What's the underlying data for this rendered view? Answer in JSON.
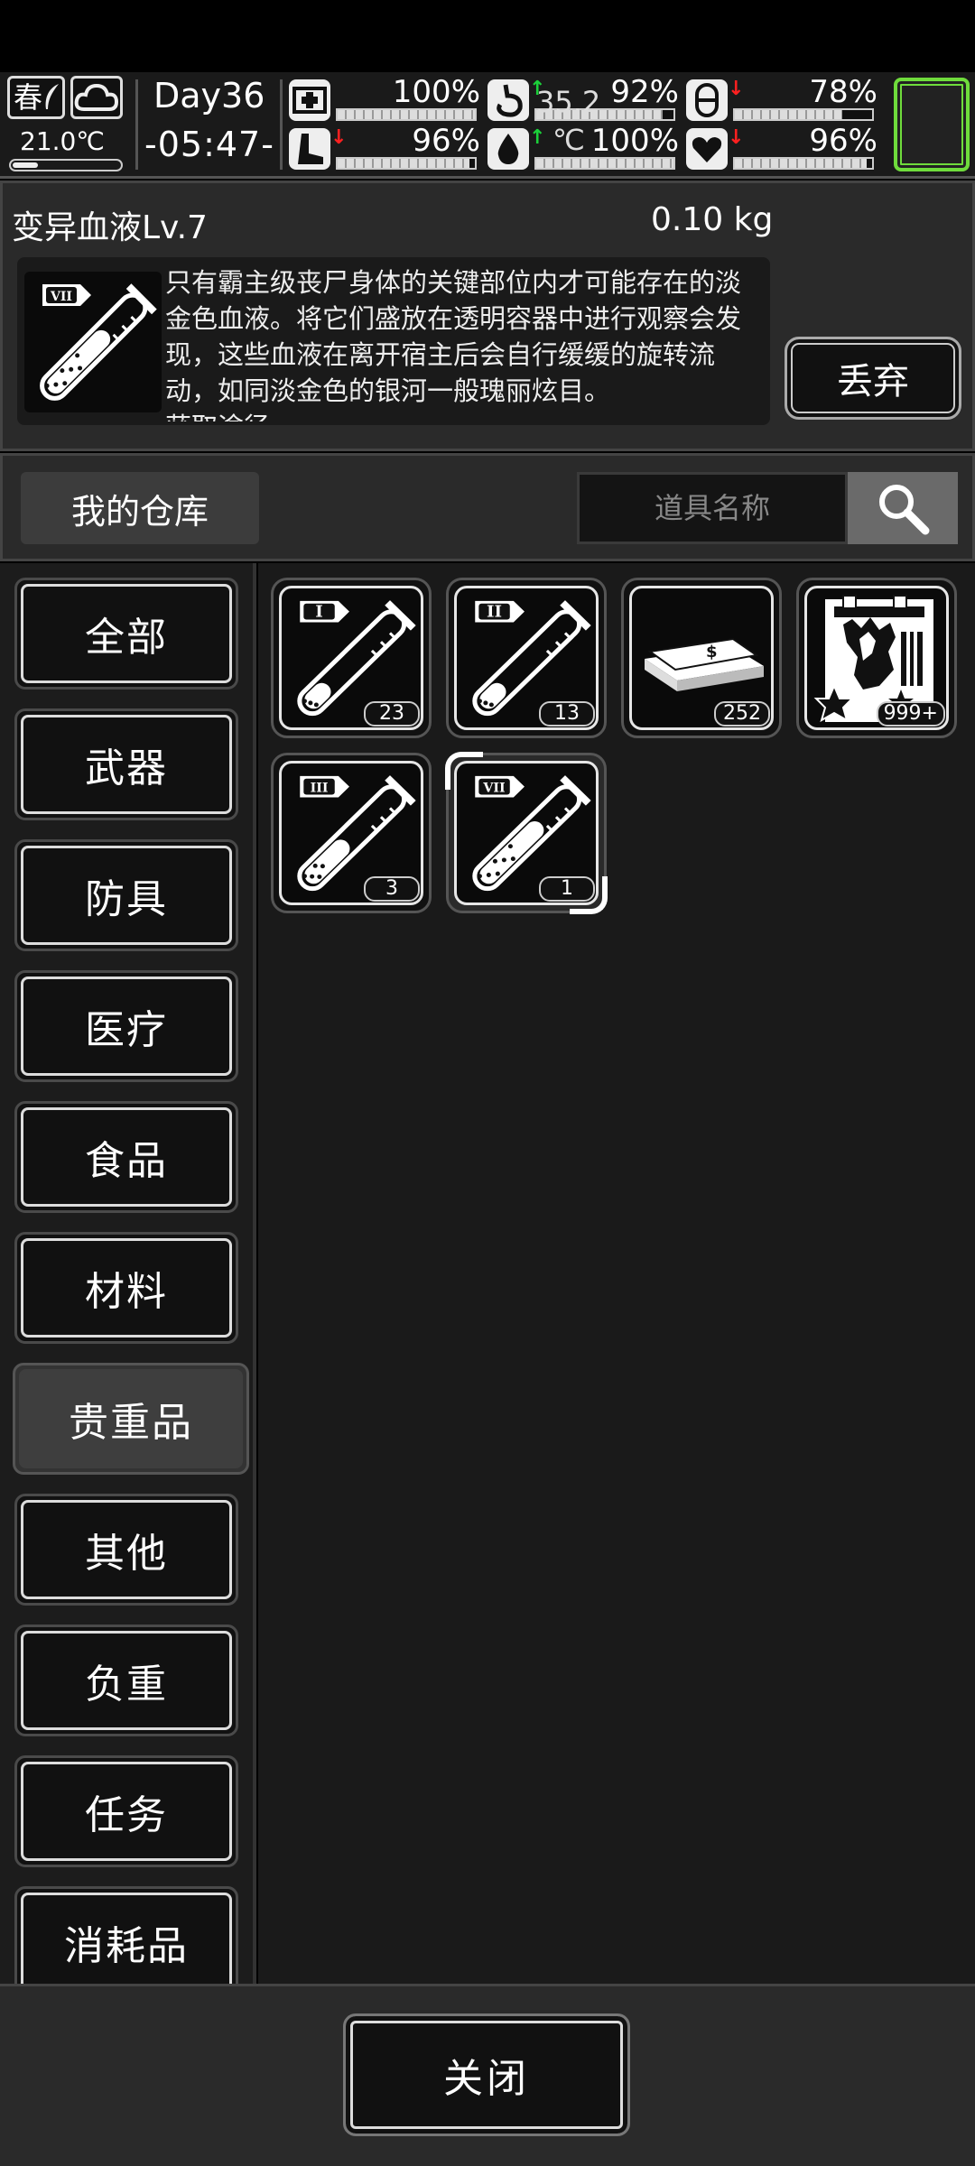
{
  "status": {
    "season": "春",
    "temperature": "21.0℃",
    "day": "Day36",
    "time": "-05:47-",
    "body_temp": "35.2",
    "body_temp_unit": "℃",
    "stats": [
      {
        "name": "health",
        "icon": "medkit-icon",
        "value": "100%",
        "level": 1.0,
        "arrow": ""
      },
      {
        "name": "hunger",
        "icon": "stomach-icon",
        "value": "92%",
        "level": 0.92,
        "arrow": "up"
      },
      {
        "name": "fatigue",
        "icon": "capsule-icon",
        "value": "78%",
        "level": 0.78,
        "arrow": "down"
      },
      {
        "name": "stamina",
        "icon": "boot-icon",
        "value": "96%",
        "level": 0.96,
        "arrow": "down"
      },
      {
        "name": "thirst",
        "icon": "water-drop-icon",
        "value": "100%",
        "level": 1.0,
        "arrow": "up"
      },
      {
        "name": "mood",
        "icon": "heart-icon",
        "value": "96%",
        "level": 0.96,
        "arrow": "down"
      }
    ]
  },
  "detail": {
    "name": "变异血液Lv.7",
    "weight": "0.10 kg",
    "tier": "VII",
    "description": "只有霸主级丧尸身体的关键部位内才可能存在的淡金色血液。将它们盛放在透明容器中进行观察会发现，这些血液在离开宿主后会自行缓缓的旋转流动，如同淡金色的银河一般瑰丽炫目。",
    "description_cut": "获取途径",
    "discard_label": "丢弃"
  },
  "warehouse": {
    "title": "我的仓库",
    "search_placeholder": "道具名称"
  },
  "categories": [
    "全部",
    "武器",
    "防具",
    "医疗",
    "食品",
    "材料",
    "贵重品",
    "其他",
    "负重",
    "任务",
    "消耗品"
  ],
  "active_category": "贵重品",
  "items": [
    {
      "name": "mutant-blood-lv1",
      "tier": "I",
      "fill": 0.25,
      "count": "23"
    },
    {
      "name": "mutant-blood-lv2",
      "tier": "II",
      "fill": 0.25,
      "count": "13"
    },
    {
      "name": "cash-stack",
      "tier": "",
      "fill": 0,
      "count": "252"
    },
    {
      "name": "zombie-trophy-card",
      "tier": "",
      "fill": 0,
      "count": "999+"
    },
    {
      "name": "mutant-blood-lv3",
      "tier": "III",
      "fill": 0.45,
      "count": "3"
    },
    {
      "name": "mutant-blood-lv7",
      "tier": "VII",
      "fill": 0.65,
      "count": "1",
      "selected": true
    }
  ],
  "footer": {
    "close_label": "关闭"
  },
  "colors": {
    "accent_green": "#6fdc3c",
    "arrow_up": "#1bd13a",
    "arrow_down": "#ff2020",
    "panel": "#2a2a2a"
  }
}
